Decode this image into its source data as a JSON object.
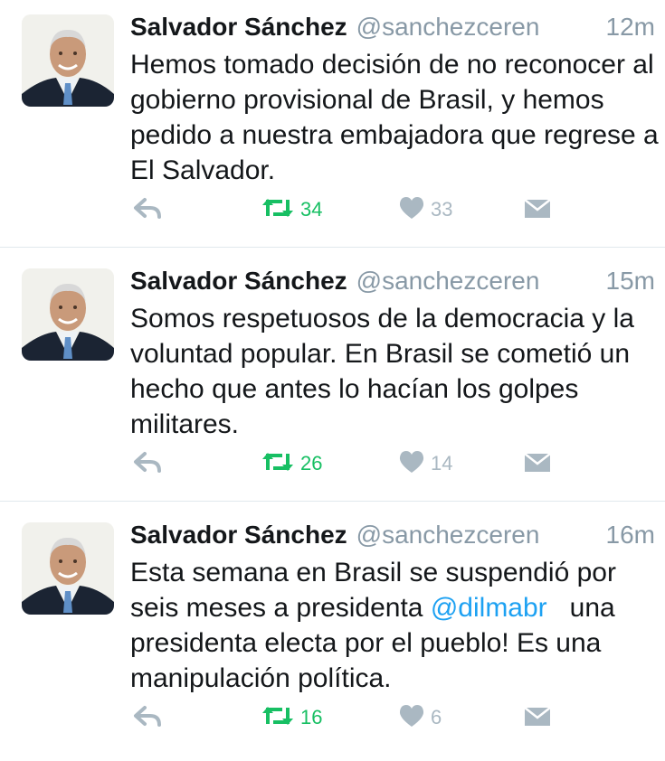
{
  "colors": {
    "retweet": "#17bf63",
    "muted": "#aab8c2",
    "mention": "#1da1f2"
  },
  "tweets": [
    {
      "name": "Salvador Sánchez",
      "handle": "@sanchezceren",
      "time": "12m",
      "text_parts": [
        "Hemos tomado decisión de no reconocer al gobierno provisional de Brasil, y hemos pedido a nuestra embajadora que regrese a El Salvador."
      ],
      "retweets": "34",
      "likes": "33",
      "icons": [
        "reply-icon",
        "retweet-icon",
        "heart-icon",
        "message-icon"
      ]
    },
    {
      "name": "Salvador Sánchez",
      "handle": "@sanchezceren",
      "time": "15m",
      "text_parts": [
        "Somos respetuosos de la democracia y la voluntad popular. En Brasil se cometió un hecho que antes lo hacían los golpes militares."
      ],
      "retweets": "26",
      "likes": "14",
      "icons": [
        "reply-icon",
        "retweet-icon",
        "heart-icon",
        "message-icon"
      ]
    },
    {
      "name": "Salvador Sánchez",
      "handle": "@sanchezceren",
      "time": "16m",
      "text_before": "Esta semana en Brasil se suspendió por seis meses a presidenta ",
      "mention": "@dilmabr",
      "text_after": "   una presidenta electa por el pueblo! Es una manipulación política.",
      "retweets": "16",
      "likes": "6",
      "icons": [
        "reply-icon",
        "retweet-icon",
        "heart-icon",
        "message-icon"
      ]
    }
  ]
}
